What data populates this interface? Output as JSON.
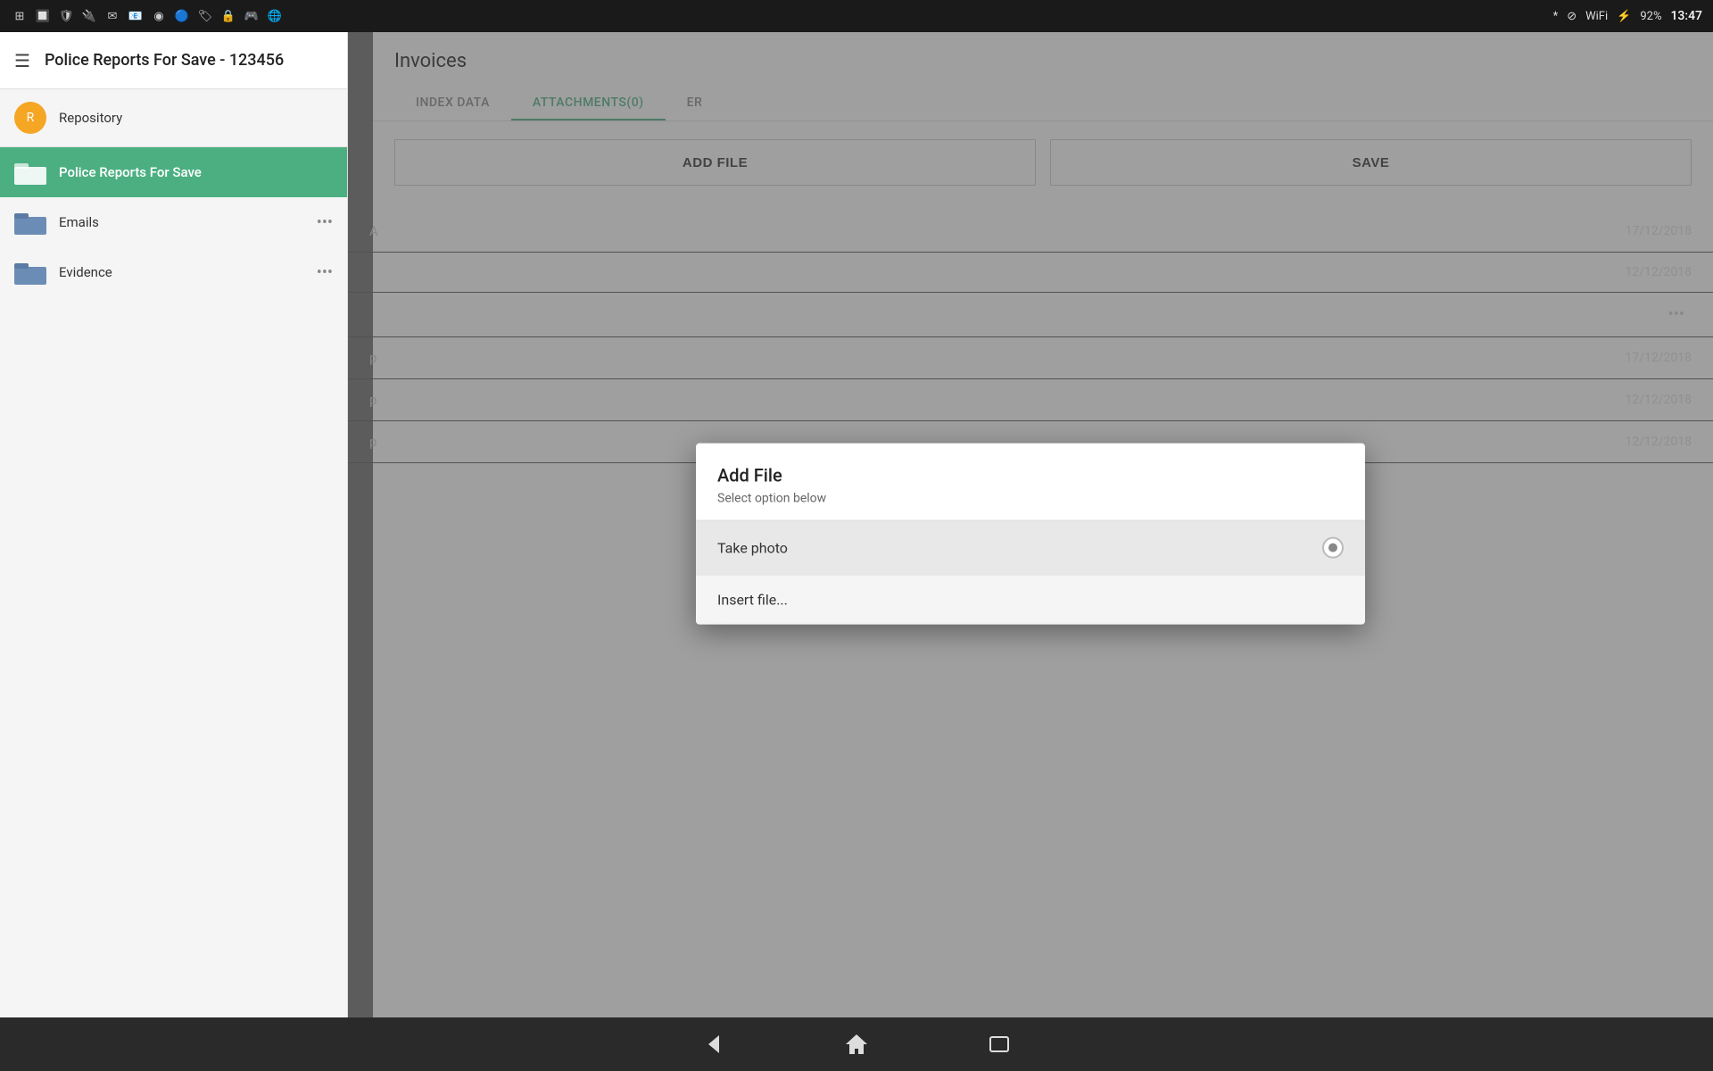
{
  "statusBar": {
    "time": "13:47",
    "battery": "92%",
    "icons": [
      "app1",
      "app2",
      "app3",
      "app4",
      "app5",
      "app6",
      "app7",
      "app8",
      "app9",
      "app10"
    ]
  },
  "sidebar": {
    "title": "Police Reports For Save - 123456",
    "items": [
      {
        "id": "repository",
        "label": "Repository",
        "type": "circle"
      },
      {
        "id": "police-reports",
        "label": "Police Reports For Save",
        "type": "folder",
        "active": true
      },
      {
        "id": "emails",
        "label": "Emails",
        "type": "folder",
        "hasMore": true
      },
      {
        "id": "evidence",
        "label": "Evidence",
        "type": "folder",
        "hasMore": true
      }
    ]
  },
  "invoices": {
    "title": "Invoices",
    "tabs": [
      {
        "id": "index-data",
        "label": "INDEX DATA",
        "active": false
      },
      {
        "id": "attachments",
        "label": "ATTACHMENTS(0)",
        "active": true
      },
      {
        "id": "er",
        "label": "ER",
        "active": false
      }
    ],
    "addFileButton": "ADD FILE",
    "saveButton": "SAVE"
  },
  "listItems": [
    {
      "date": "17/12/2018",
      "hasMore": false
    },
    {
      "date": "12/12/2018",
      "hasMore": false
    },
    {
      "date": "",
      "hasMore": true
    },
    {
      "date": "17/12/2018",
      "hasMore": false
    },
    {
      "date": "12/12/2018",
      "hasMore": false
    },
    {
      "date": "12/12/2018",
      "hasMore": false
    }
  ],
  "dialog": {
    "title": "Add File",
    "subtitle": "Select option below",
    "options": [
      {
        "id": "take-photo",
        "label": "Take photo",
        "selected": true
      },
      {
        "id": "insert-file",
        "label": "Insert file...",
        "selected": false
      }
    ]
  },
  "bottomNav": {
    "backLabel": "◁",
    "homeLabel": "△",
    "squareLabel": "□"
  }
}
